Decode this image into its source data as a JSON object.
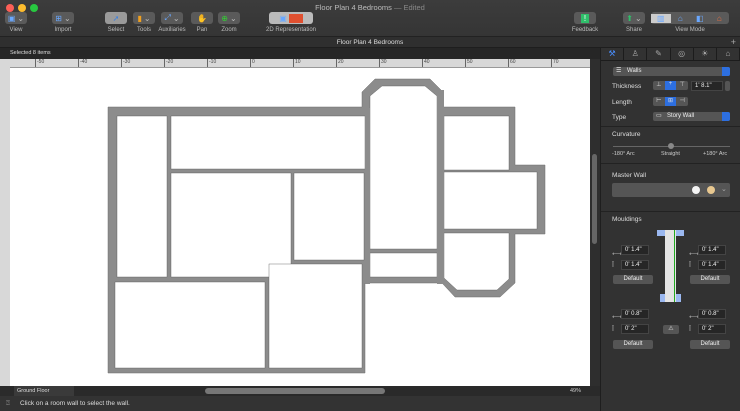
{
  "window": {
    "title": "Floor Plan 4 Bedrooms",
    "title_suffix": "— Edited"
  },
  "toolbar": {
    "items": [
      {
        "label": "View",
        "icon": "view-icon"
      },
      {
        "label": "Import",
        "icon": "import-icon"
      },
      {
        "label": "Select",
        "icon": "cursor-icon"
      },
      {
        "label": "Tools",
        "icon": "tools-icon"
      },
      {
        "label": "Auxiliaries",
        "icon": "auxiliaries-icon"
      },
      {
        "label": "Pan",
        "icon": "hand-icon"
      },
      {
        "label": "Zoom",
        "icon": "zoom-icon"
      },
      {
        "label": "2D Representation",
        "icon": "2d-representation-icon"
      },
      {
        "label": "Feedback",
        "icon": "feedback-icon"
      },
      {
        "label": "Share",
        "icon": "share-icon"
      },
      {
        "label": "View Mode",
        "icon": "view-mode-icon"
      }
    ]
  },
  "document_tab": "Floor Plan 4 Bedrooms",
  "selection_info": "Selected 8 items",
  "ruler": {
    "unit": "ft",
    "ticks": [
      "-50",
      "-40",
      "-30",
      "-20",
      "-10",
      "0",
      "10",
      "20",
      "30",
      "40",
      "50",
      "60",
      "70"
    ]
  },
  "bottom": {
    "floor": "Ground Floor",
    "zoom": "49%"
  },
  "status": "Click on a room wall to select the wall.",
  "panel": {
    "category": "Walls",
    "thickness_label": "Thickness",
    "thickness_value": "1' 8.1\"",
    "length_label": "Length",
    "type_label": "Type",
    "type_value": "Story Wall",
    "curvature_label": "Curvature",
    "curvature_min": "-180° Arc",
    "curvature_mid": "Straight",
    "curvature_max": "+180° Arc",
    "curvature_value": 0,
    "master_wall_label": "Master Wall",
    "mouldings_label": "Mouldings",
    "mouldings": {
      "top_left": {
        "width": "0' 1.4\"",
        "height": "0' 1.4\"",
        "default": "Default"
      },
      "top_right": {
        "width": "0' 1.4\"",
        "height": "0' 1.4\"",
        "default": "Default"
      },
      "bottom_left": {
        "width": "0' 0.8\"",
        "height": "0' 2\"",
        "default": "Default"
      },
      "bottom_right": {
        "width": "0' 0.8\"",
        "height": "0' 2\"",
        "default": "Default"
      }
    }
  },
  "colors": {
    "accent": "#2d6fe0",
    "wall": "#8c8c8c",
    "feedback": "#2fbf6a"
  }
}
